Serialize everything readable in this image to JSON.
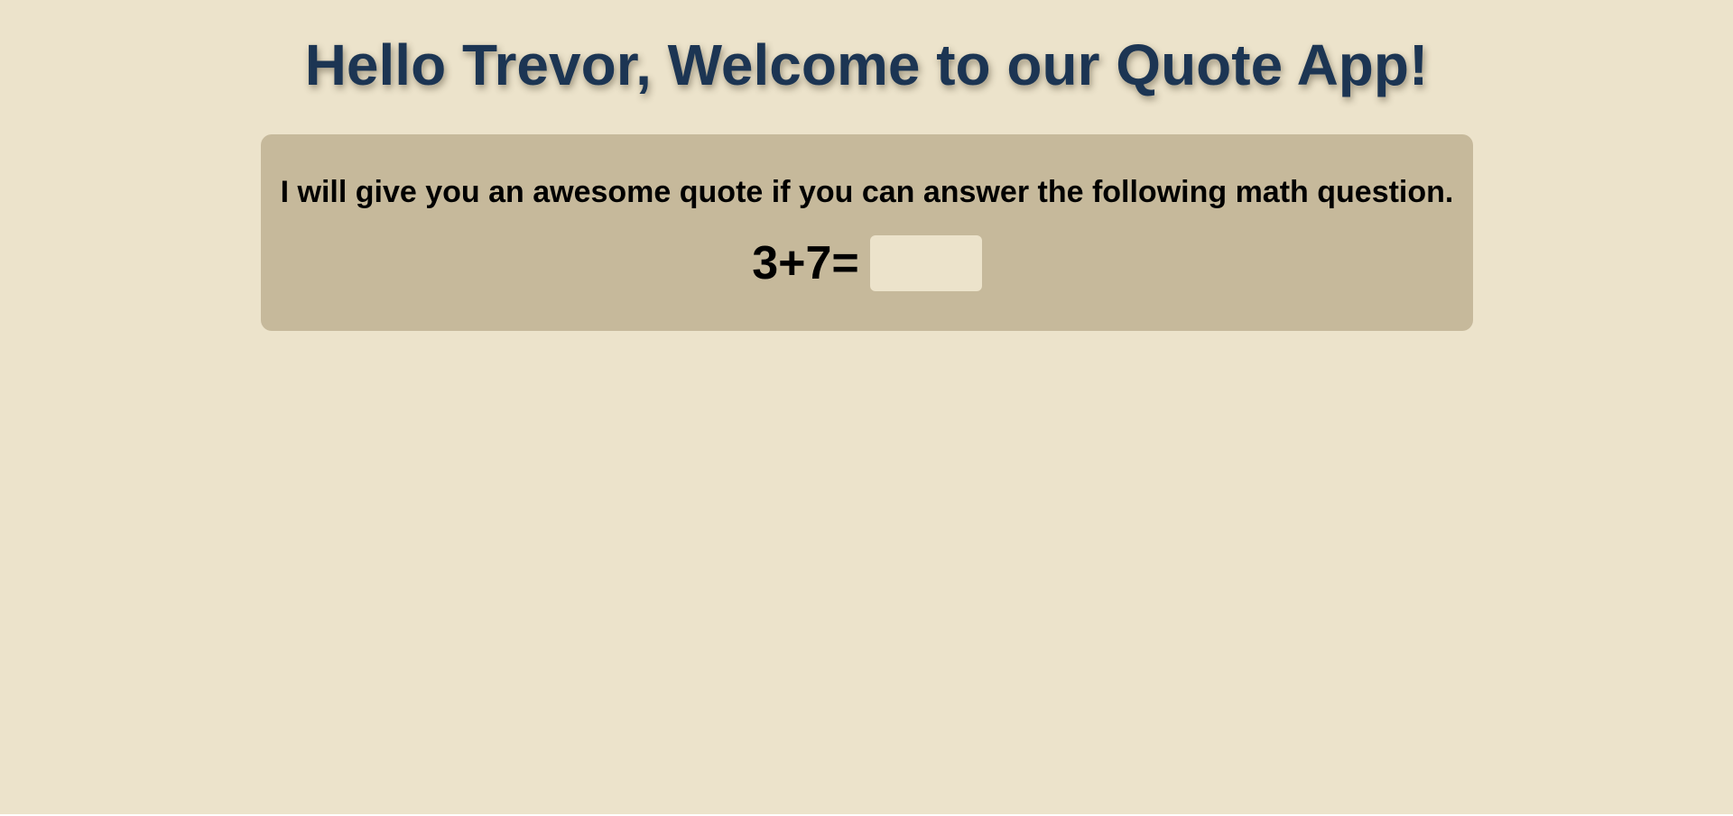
{
  "header": {
    "title": "Hello Trevor, Welcome to our Quote App!"
  },
  "quiz": {
    "intro": "I will give you an awesome quote if you can answer the following math question.",
    "equation": "3+7=",
    "answer_value": "",
    "answer_placeholder": ""
  },
  "colors": {
    "background": "#ece3cb",
    "panel": "#c6b99b",
    "title": "#1c3553",
    "text": "#000000",
    "input_background": "#ece3cb"
  }
}
